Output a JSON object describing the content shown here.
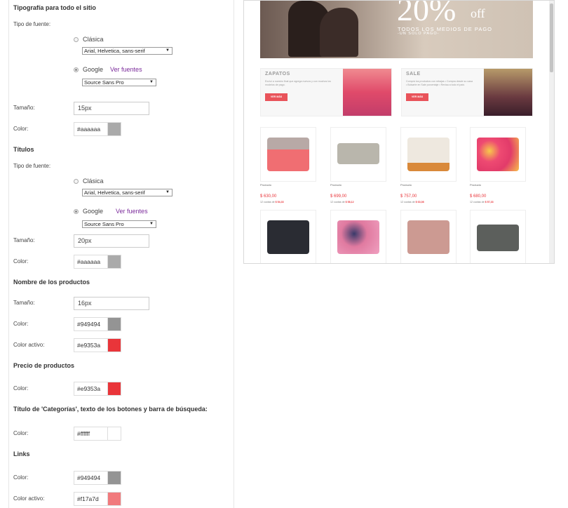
{
  "sections": {
    "site_typography": {
      "title": "Tipografía para todo el sitio",
      "font_type_label": "Tipo de fuente:",
      "classic_label": "Clásica",
      "classic_select": "Arial, Helvetica, sans-serif",
      "google_label": "Google",
      "google_link": "Ver fuentes",
      "google_select": "Source Sans Pro",
      "size_label": "Tamaño:",
      "size_value": "15px",
      "color_label": "Color:",
      "color_value": "#aaaaaa"
    },
    "titles": {
      "title": "Títulos",
      "font_type_label": "Tipo de fuente:",
      "classic_label": "Clásica",
      "classic_select": "Arial, Helvetica, sans-serif",
      "google_label": "Google",
      "google_link": "Ver fuentes",
      "google_select": "Source Sans Pro",
      "size_label": "Tamaño:",
      "size_value": "20px",
      "color_label": "Color:",
      "color_value": "#aaaaaa"
    },
    "product_names": {
      "title": "Nombre de los productos",
      "size_label": "Tamaño:",
      "size_value": "16px",
      "color_label": "Color:",
      "color_value": "#949494",
      "active_color_label": "Color activo:",
      "active_color_value": "#e9353a"
    },
    "product_prices": {
      "title": "Precio de productos",
      "color_label": "Color:",
      "color_value": "#e9353a"
    },
    "categories": {
      "title": "Título de 'Categorías', texto de los botones y barra de búsqueda:",
      "color_label": "Color:",
      "color_value": "#ffffff"
    },
    "links": {
      "title": "Links",
      "color_label": "Color:",
      "color_value": "#949494",
      "active_color_label": "Color activo:",
      "active_color_value": "#f17a7d"
    }
  },
  "colors": {
    "swatch_gray_light": "#aaaaaa",
    "swatch_gray": "#949494",
    "swatch_red": "#e9353a",
    "swatch_white": "#ffffff",
    "swatch_pink": "#f17a7d",
    "accent_purple": "#7a2a9a"
  },
  "preview": {
    "hero": {
      "big": "20%",
      "off": "off",
      "line1": "TODOS LOS MEDIOS DE PAGO",
      "line2": "-UN SOLO PAGO-"
    },
    "promos": [
      {
        "title": "ZAPATOS",
        "desc": "Excluí a nuestro final que agrega nuevos y con muchos los modelos de pago.",
        "button": "VER MÁS"
      },
      {
        "title": "SALE",
        "desc": "Comprá los productos con rebajas • Compra desde su casa • Bolsarte en Sale porcentaje • Revisa a todo el país",
        "button": "VER MÁS"
      }
    ],
    "products": [
      {
        "label": "Producto",
        "price": "$ 630,00",
        "cuotas": "12 cuotas de",
        "cuota_value": "$ 54,33"
      },
      {
        "label": "Producto",
        "price": "$ 699,00",
        "cuotas": "12 cuotas de",
        "cuota_value": "$ 58,12"
      },
      {
        "label": "Producto",
        "price": "$ 757,00",
        "cuotas": "12 cuotas de",
        "cuota_value": "$ 63,08"
      },
      {
        "label": "Producto",
        "price": "$ 680,00",
        "cuotas": "12 cuotas de",
        "cuota_value": "$ 57,33"
      }
    ]
  }
}
